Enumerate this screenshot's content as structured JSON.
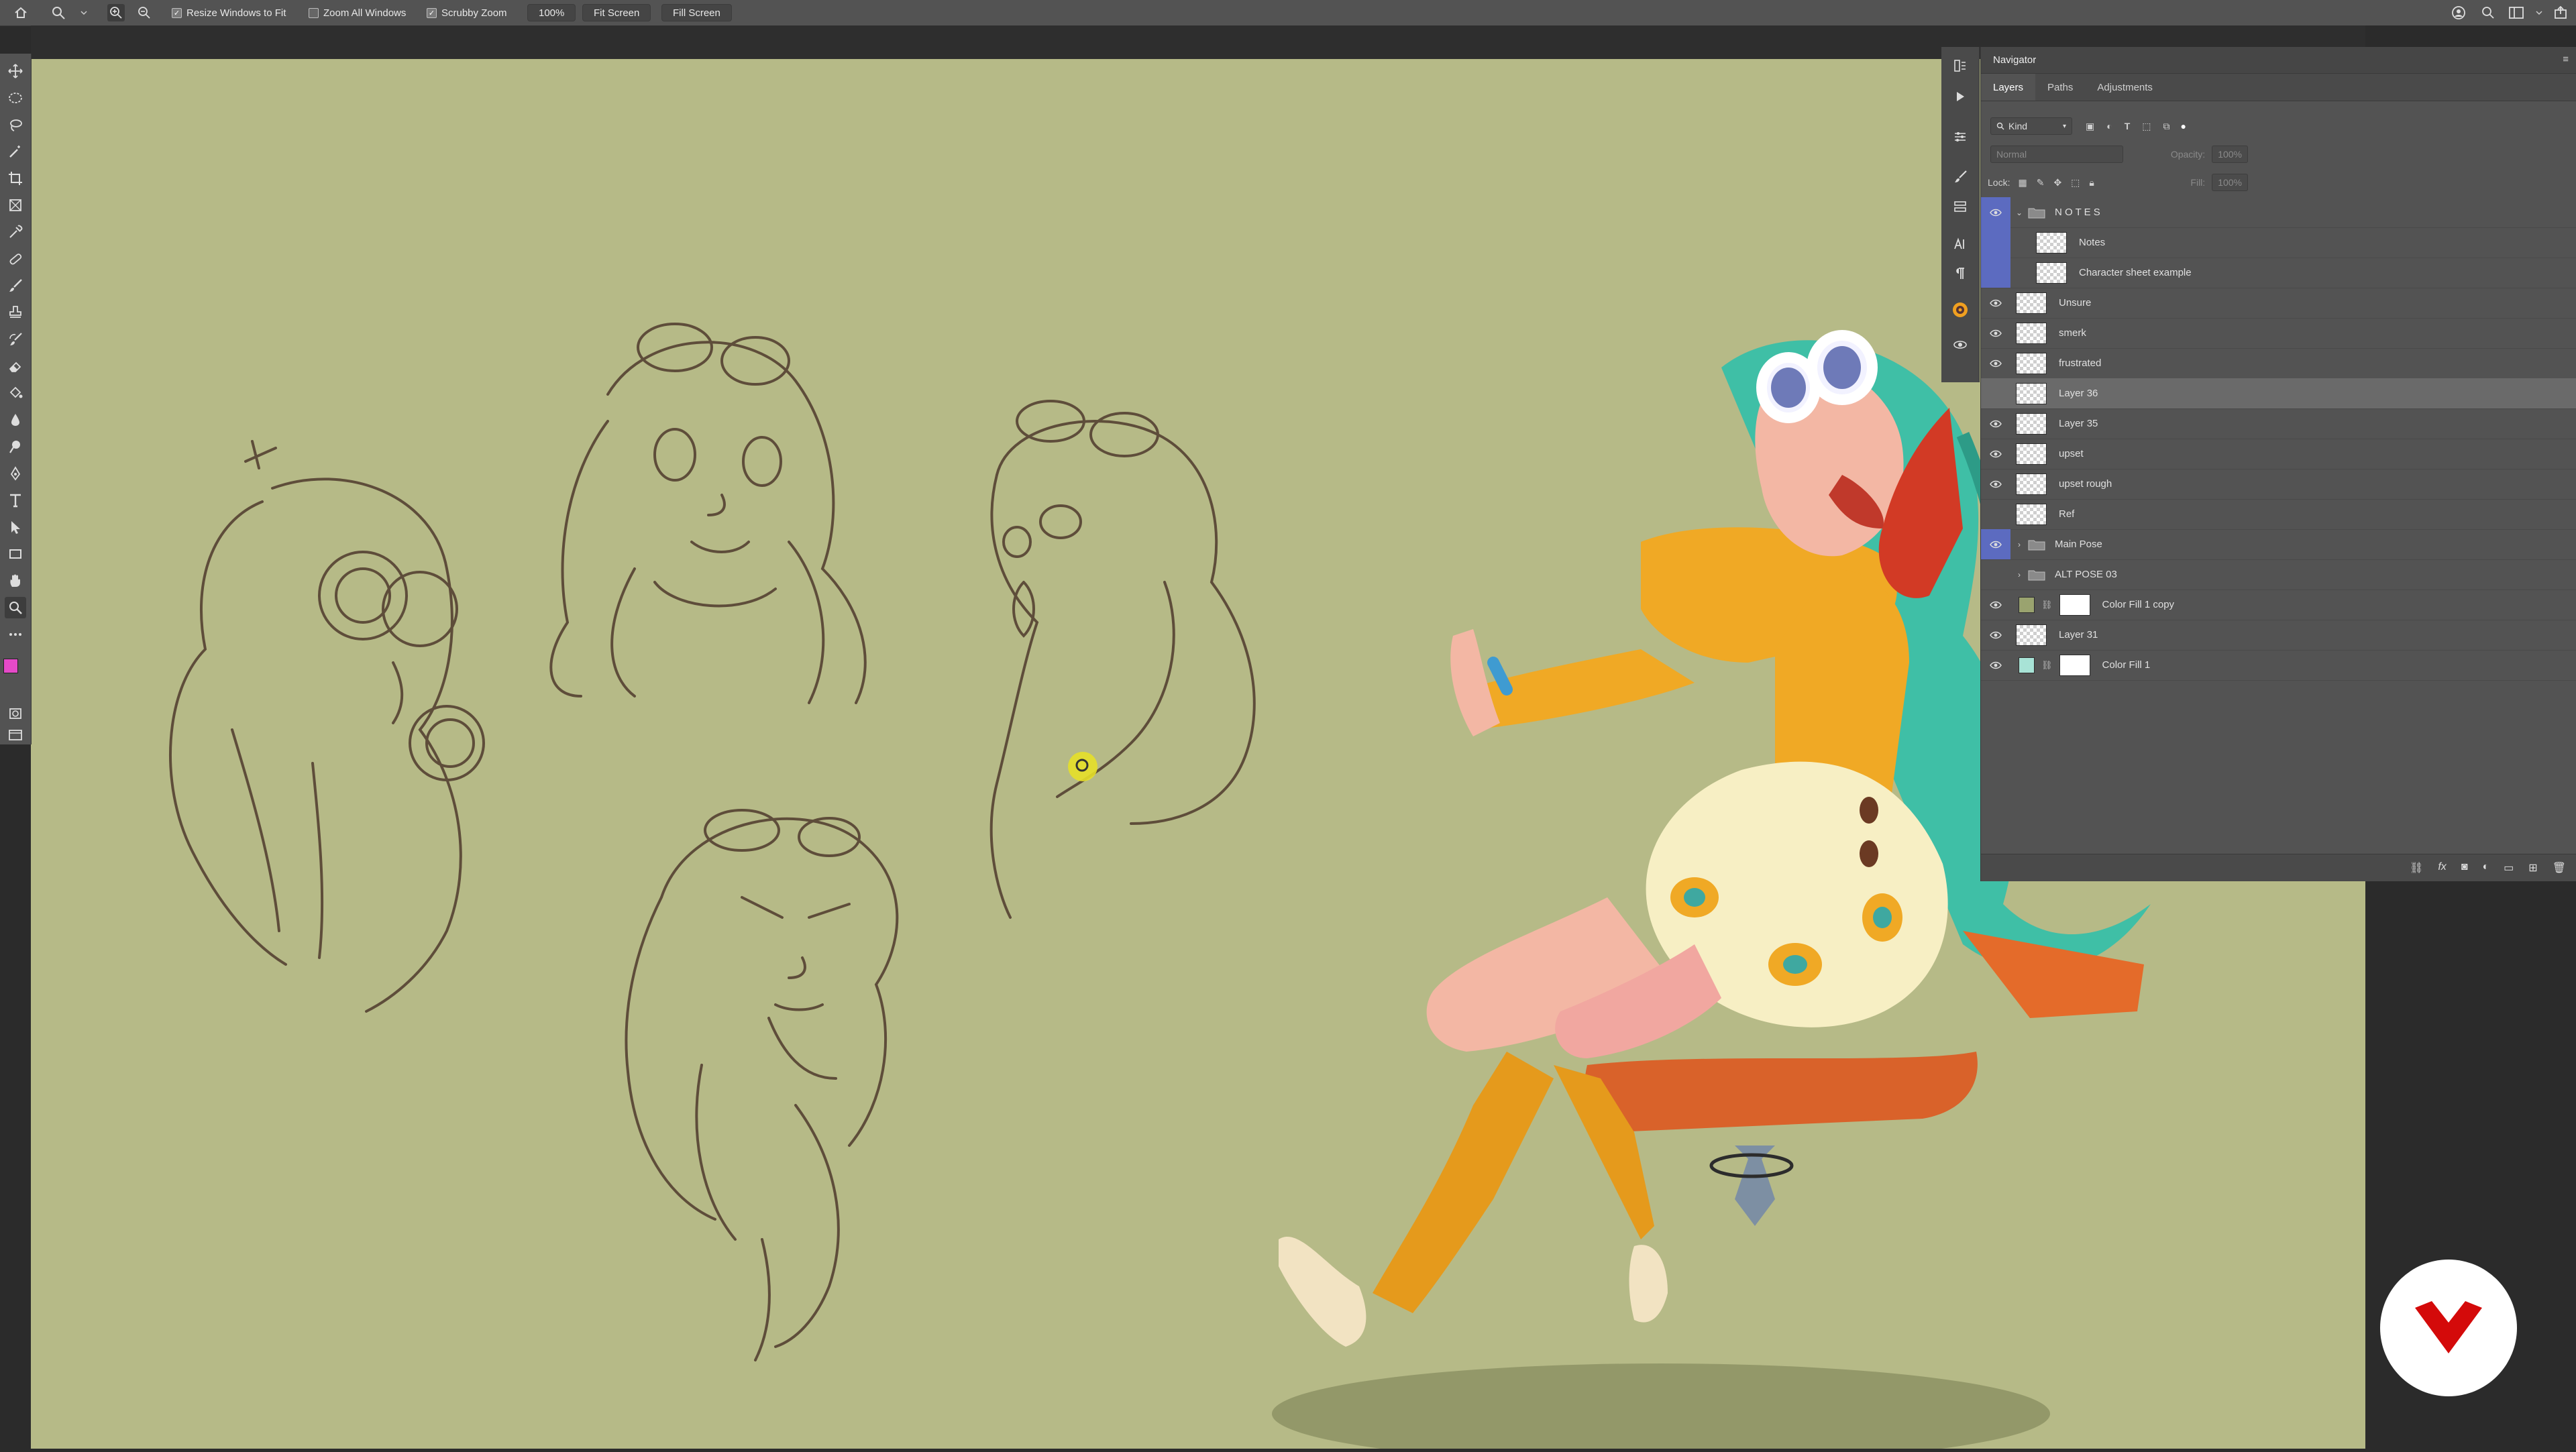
{
  "options_bar": {
    "resize_windows": "Resize Windows to Fit",
    "zoom_all_windows": "Zoom All Windows",
    "scrubby_zoom": "Scrubby Zoom",
    "zoom_level": "100%",
    "fit_screen": "Fit Screen",
    "fill_screen": "Fill Screen"
  },
  "panel": {
    "title": "Navigator",
    "tabs": [
      "Layers",
      "Paths",
      "Adjustments"
    ],
    "filter_kind": "Kind",
    "blend_mode": "Normal",
    "opacity_label": "Opacity:",
    "opacity_value": "100%",
    "lock_label": "Lock:",
    "fill_label": "Fill:",
    "fill_value": "100%"
  },
  "layers": [
    {
      "name": "N O T E S",
      "type": "group",
      "visible": true,
      "open": true
    },
    {
      "name": "Notes",
      "type": "layer",
      "visible": false,
      "indent": true
    },
    {
      "name": "Character sheet example",
      "type": "layer",
      "visible": false,
      "indent": true
    },
    {
      "name": "Unsure",
      "type": "layer",
      "visible": true
    },
    {
      "name": "smerk",
      "type": "layer",
      "visible": true
    },
    {
      "name": "frustrated",
      "type": "layer",
      "visible": true
    },
    {
      "name": "Layer 36",
      "type": "layer",
      "visible": false,
      "selected": true
    },
    {
      "name": "Layer 35",
      "type": "layer",
      "visible": true
    },
    {
      "name": "upset",
      "type": "layer",
      "visible": true
    },
    {
      "name": "upset rough",
      "type": "layer",
      "visible": true
    },
    {
      "name": "Ref",
      "type": "layer",
      "visible": false
    },
    {
      "name": "Main Pose",
      "type": "group",
      "visible": true
    },
    {
      "name": "ALT POSE 03",
      "type": "group",
      "visible": false
    },
    {
      "name": "Color Fill 1 copy",
      "type": "fill",
      "visible": true,
      "swatch": "#9aa36f"
    },
    {
      "name": "Layer 31",
      "type": "layer",
      "visible": true
    },
    {
      "name": "Color Fill 1",
      "type": "fill",
      "visible": true,
      "swatch": "#a8e3d6"
    }
  ],
  "colors": {
    "canvas": "#b6ba87",
    "foreground": "#e54ac8",
    "background": "#111111",
    "logo": "#d40a0a"
  }
}
